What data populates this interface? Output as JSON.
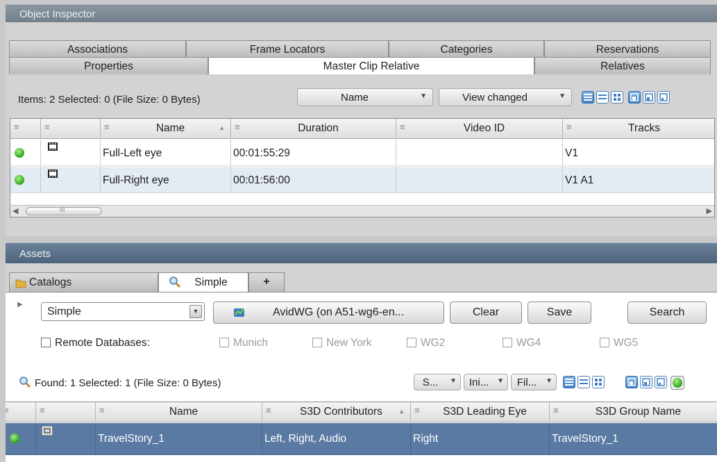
{
  "object_inspector": {
    "title": "Object Inspector",
    "tabs_row1": [
      "Associations",
      "Frame Locators",
      "Categories",
      "Reservations"
    ],
    "tabs_row2": [
      "Properties",
      "Master Clip Relative",
      "Relatives"
    ],
    "active_tab": "Master Clip Relative",
    "status": "Items: 2 Selected: 0 (File Size: 0 Bytes)",
    "sort_dropdown": "Name",
    "view_dropdown": "View changed",
    "columns": [
      "Name",
      "Duration",
      "Video ID",
      "Tracks"
    ],
    "rows": [
      {
        "name": "Full-Left eye",
        "duration": "00:01:55:29",
        "video_id": "",
        "tracks": "V1"
      },
      {
        "name": "Full-Right eye",
        "duration": "00:01:56:00",
        "video_id": "",
        "tracks": "V1 A1"
      }
    ]
  },
  "assets": {
    "title": "Assets",
    "tabs": [
      "Catalogs",
      "Simple",
      "+"
    ],
    "active_tab": "Simple",
    "search_type": "Simple",
    "database_button": "AvidWG (on A51-wg6-en...",
    "clear_button": "Clear",
    "save_button": "Save",
    "search_button": "Search",
    "remote_label": "Remote Databases:",
    "remote_dbs": [
      "Munich",
      "New York",
      "WG2",
      "WG4",
      "WG5"
    ],
    "status": "Found: 1 Selected: 1 (File Size: 0 Bytes)",
    "mini_dropdowns": [
      "S...",
      "Ini...",
      "Fil..."
    ],
    "columns": [
      "Name",
      "S3D Contributors",
      "S3D Leading Eye",
      "S3D Group Name"
    ],
    "rows": [
      {
        "name": "TravelStory_1",
        "contributors": "Left, Right, Audio",
        "leading_eye": "Right",
        "group_name": "TravelStory_1"
      }
    ]
  },
  "icons": {
    "status_dot": "green-status-dot",
    "clip_icon": "film-clip-icon",
    "folder": "folder-icon",
    "search": "magnifier-icon"
  },
  "colors": {
    "title_bar": "#6a8199",
    "selected_row": "#5a7aa3",
    "status_green": "#2ea31a"
  }
}
